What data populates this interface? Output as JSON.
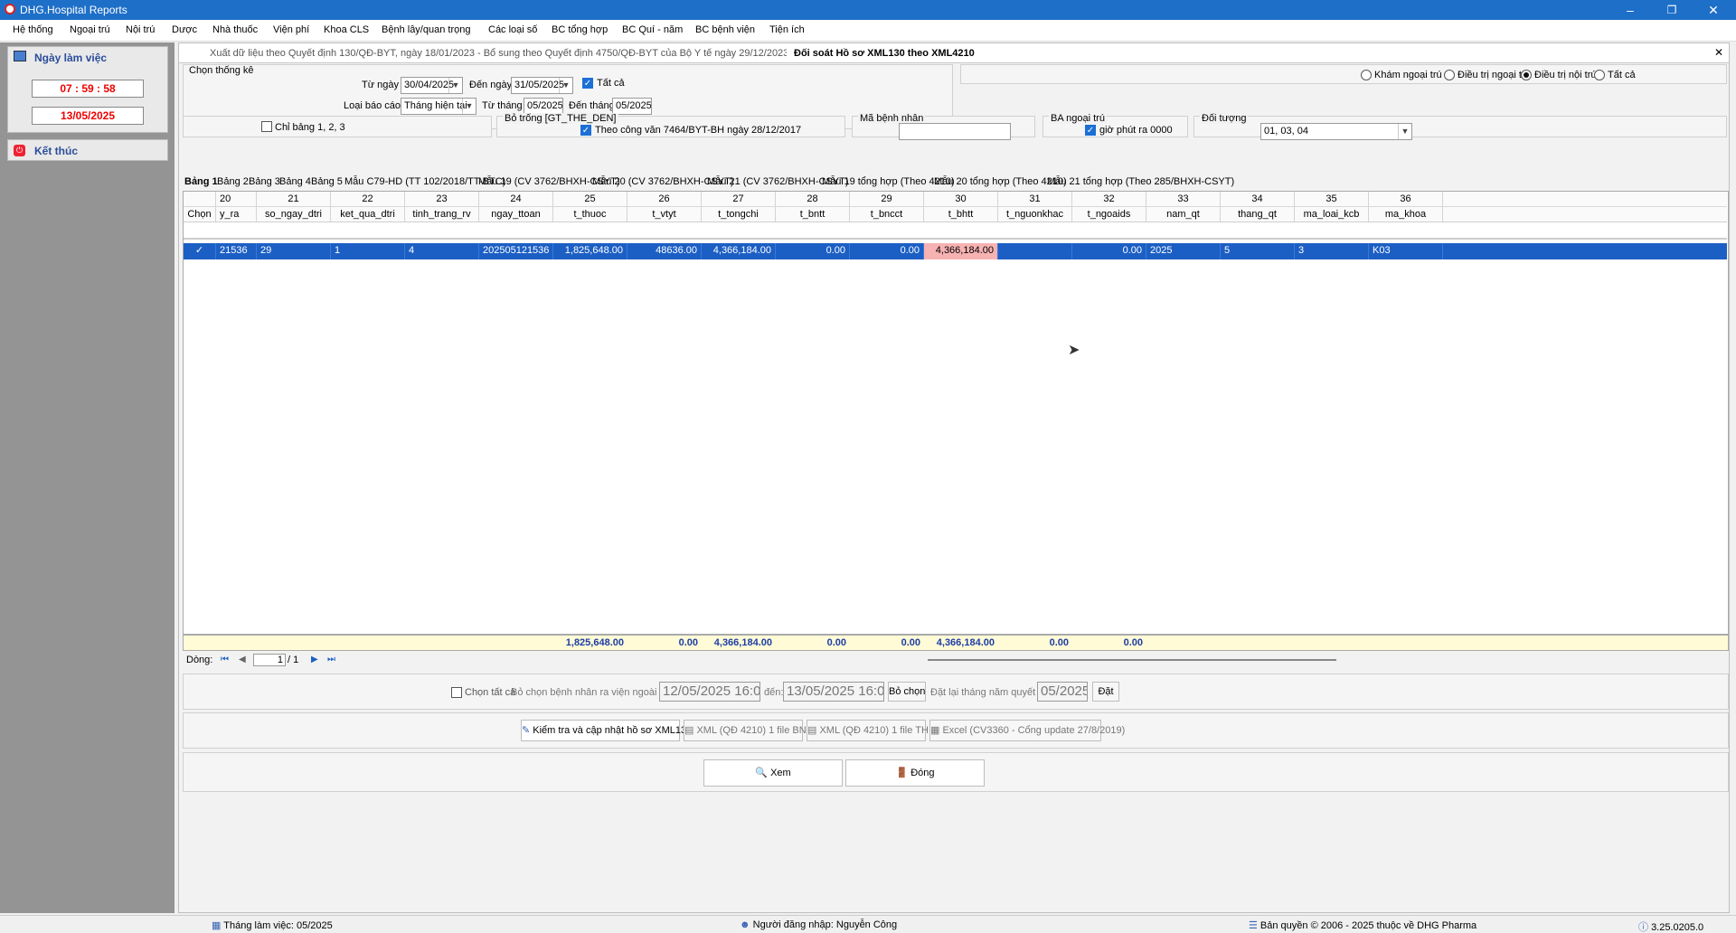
{
  "app": {
    "title": "DHG.Hospital Reports"
  },
  "menu": [
    "Hệ thống",
    "Ngoại trú",
    "Nội trú",
    "Dược",
    "Nhà thuốc",
    "Viện phí",
    "Khoa CLS",
    "Bệnh lây/quan trọng",
    "Các loại số",
    "BC tổng hợp",
    "BC Quí - năm",
    "BC bệnh viện",
    "Tiện ích"
  ],
  "left": {
    "workday_label": "Ngày làm việc",
    "time": "07 : 59 : 58",
    "date": "13/05/2025",
    "exit_label": "Kết thúc"
  },
  "doc_tabs": [
    "Xuất dữ liệu theo Quyết định 130/QĐ-BYT, ngày 18/01/2023 - Bổ sung theo Quyết định 4750/QĐ-BYT của Bộ Y tế ngày 29/12/2023",
    "Đối soát Hồ sơ XML130 theo XML4210"
  ],
  "filter": {
    "group_title": "Chọn thống kê",
    "from_date_label": "Từ ngày :",
    "from_date": "30/04/2025",
    "to_date_label": "Đến ngày :",
    "to_date": "31/05/2025",
    "all_label": "Tất cả",
    "report_type_label": "Loại báo cáo :",
    "report_type": "Tháng hiện tại",
    "from_month_label": "Từ tháng :",
    "from_month": "05/2025",
    "to_month_label": "Đến tháng :",
    "to_month": "05/2025",
    "radios": [
      "Khám ngoại trú",
      "Điều trị ngoại trú",
      "Điều trị nội trú",
      "Tất cả"
    ],
    "selected_radio": "Điều trị nội trú",
    "only_tables_label": "Chỉ bảng 1, 2, 3",
    "empty_card_label": "Bỏ trống [GT_THE_DEN]",
    "cv_label": "Theo công văn 7464/BYT-BH ngày 28/12/2017",
    "patient_code_label": "Mã bệnh nhân",
    "patient_code": "",
    "ba_label": "BA ngoại trú",
    "minute_label": "giờ phút ra 0000",
    "subject_label": "Đối tượng",
    "subject": "01, 03, 04"
  },
  "sub_tabs": [
    "Bảng 1",
    "Bảng 2",
    "Bảng 3",
    "Bảng 4",
    "Bảng 5",
    "Mẫu C79-HD (TT 102/2018/TT-BTC)",
    "Mẫu 19 (CV 3762/BHXH-CSYT)",
    "Mẫu 20 (CV 3762/BHXH-CSYT)",
    "Mẫu 21 (CV 3762/BHXH-CSYT)",
    "Mẫu 19 tổng hợp (Theo 4210)",
    "Mẫu 20 tổng hợp (Theo 4210)",
    "Mẫu 21 tổng hợp (Theo 285/BHXH-CSYT)"
  ],
  "grid": {
    "select_col": "Chọn",
    "col_numbers": [
      "20",
      "21",
      "22",
      "23",
      "24",
      "25",
      "26",
      "27",
      "28",
      "29",
      "30",
      "31",
      "32",
      "33",
      "34",
      "35",
      "36"
    ],
    "columns": [
      "y_ra",
      "so_ngay_dtri",
      "ket_qua_dtri",
      "tinh_trang_rv",
      "ngay_ttoan",
      "t_thuoc",
      "t_vtyt",
      "t_tongchi",
      "t_bntt",
      "t_bncct",
      "t_bhtt",
      "t_nguonkhac",
      "t_ngoaids",
      "nam_qt",
      "thang_qt",
      "ma_loai_kcb",
      "ma_khoa"
    ],
    "rows": [
      [
        "21536",
        "29",
        "1",
        "4",
        "202505121536",
        "1,825,648.00",
        "48636.00",
        "4,366,184.00",
        "0.00",
        "0.00",
        "4,366,184.00",
        "",
        "0.00",
        "2025",
        "5",
        "3",
        "K03"
      ]
    ],
    "totals": [
      "",
      "",
      "",
      "",
      "",
      "1,825,648.00",
      "0.00",
      "4,366,184.00",
      "0.00",
      "0.00",
      "4,366,184.00",
      "0.00",
      "0.00",
      "",
      "",
      "",
      ""
    ],
    "pager_label": "Dòng:",
    "page": "1",
    "page_total": "/ 1"
  },
  "bottom": {
    "select_all_label": "Chọn tất cả",
    "exclude_label": "Bỏ chọn bệnh nhân ra viện ngoài vùng từ:",
    "exclude_from": "12/05/2025 16:00",
    "den_label": "đến:",
    "exclude_to": "13/05/2025 16:00",
    "exclude_button": "Bỏ chọn",
    "reset_label": "Đặt lại tháng năm quyết toán:",
    "reset_value": "05/2025",
    "set_button": "Đặt"
  },
  "actions": [
    "Kiểm tra và cập nhật hồ sơ XML130",
    "XML (QĐ 4210) 1 file BN",
    "XML (QĐ 4210) 1 file TH",
    "Excel (CV3360 - Cổng update 27/8/2019)"
  ],
  "footer_buttons": {
    "view": "Xem",
    "close": "Đóng"
  },
  "status": {
    "month": "Tháng làm việc: 05/2025",
    "user": "Người đăng nhập: Nguyễn Công",
    "copyright": "Bản quyền © 2006 - 2025 thuộc về DHG Pharma",
    "version": "3.25.0205.0"
  }
}
